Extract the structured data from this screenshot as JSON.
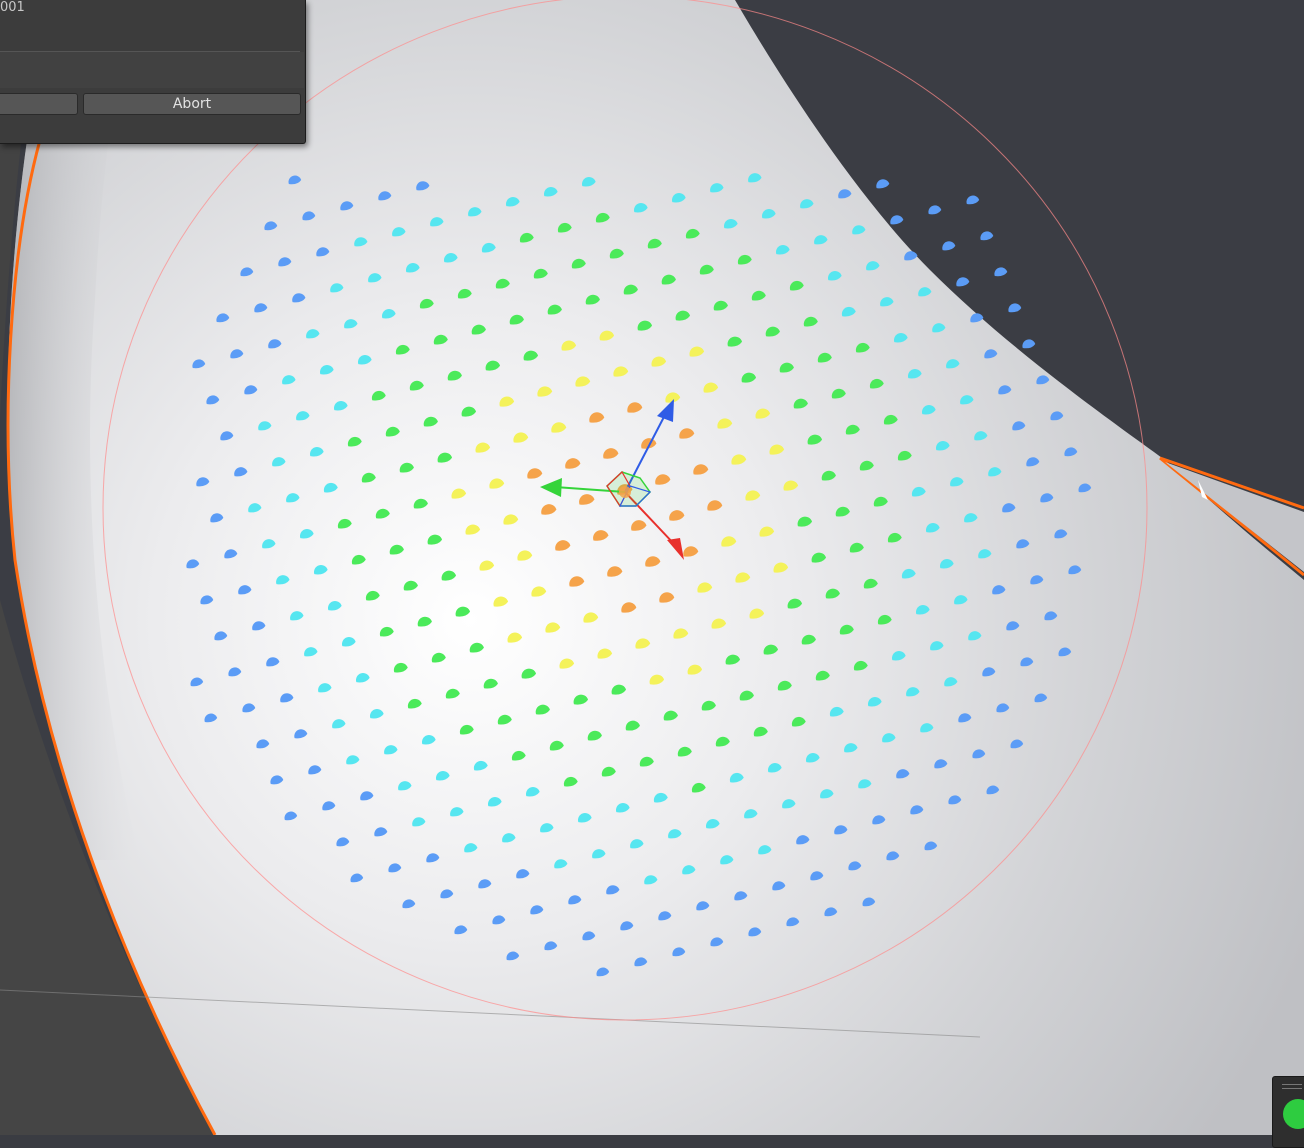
{
  "panel": {
    "id_text": "001",
    "left_button_label": "",
    "abort_label": "Abort"
  },
  "scene": {
    "surface_color": "#e8e8ea",
    "background_color": "#3a3c42",
    "selection_outline_color": "#ff6a10",
    "brush_circle_color": "#ff8a8a",
    "axis_colors": {
      "x": "#e8302c",
      "y": "#35d43a",
      "z": "#2f5ce6"
    },
    "vertex_weight_gradient": [
      "#5b9cf6",
      "#56e6f0",
      "#4bea5a",
      "#f4f25a",
      "#f5a34a"
    ]
  },
  "status_indicator": {
    "color": "#2ecc40"
  }
}
